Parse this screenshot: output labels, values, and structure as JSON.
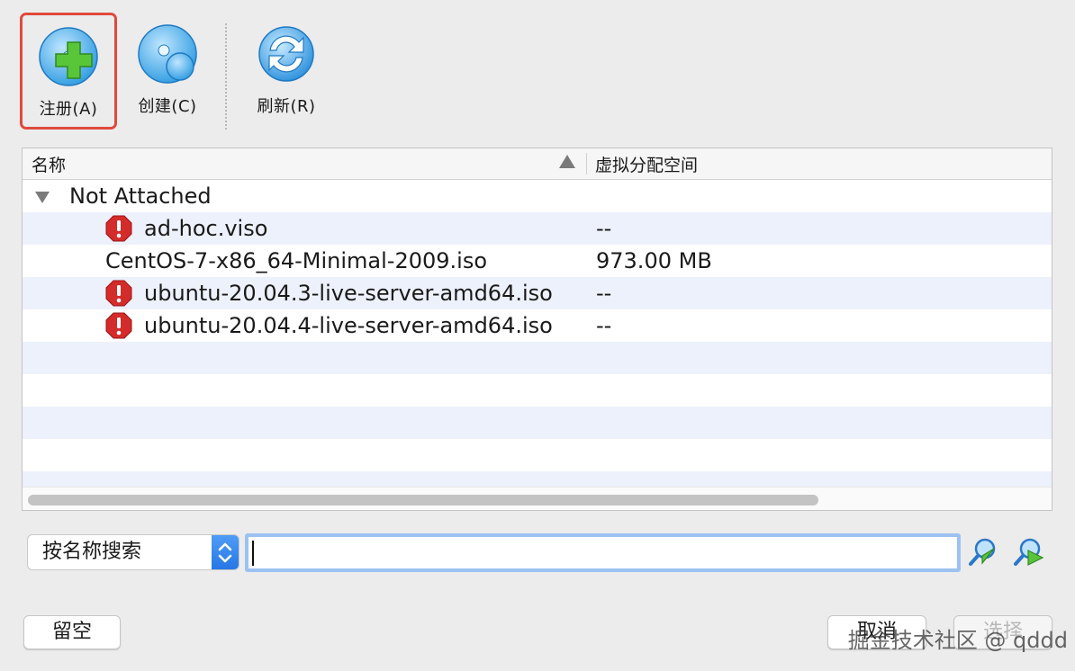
{
  "toolbar": {
    "add_label": "注册(A)",
    "create_label": "创建(C)",
    "refresh_label": "刷新(R)"
  },
  "table": {
    "columns": {
      "name": "名称",
      "size": "虚拟分配空间"
    },
    "group": {
      "label": "Not Attached"
    },
    "rows": [
      {
        "name": "ad-hoc.viso",
        "size": "--",
        "error": true
      },
      {
        "name": "CentOS-7-x86_64-Minimal-2009.iso",
        "size": "973.00 MB",
        "error": false
      },
      {
        "name": "ubuntu-20.04.3-live-server-amd64.iso",
        "size": "--",
        "error": true
      },
      {
        "name": "ubuntu-20.04.4-live-server-amd64.iso",
        "size": "--",
        "error": true
      }
    ]
  },
  "search": {
    "mode": "按名称搜索",
    "value": ""
  },
  "buttons": {
    "leave_empty": "留空",
    "cancel": "取消",
    "choose": "选择"
  },
  "watermark": "掘金技术社区 @ qddd",
  "colors": {
    "highlight": "#e04a3c",
    "accent": "#2677e6",
    "row_alt": "#edf1fb"
  }
}
